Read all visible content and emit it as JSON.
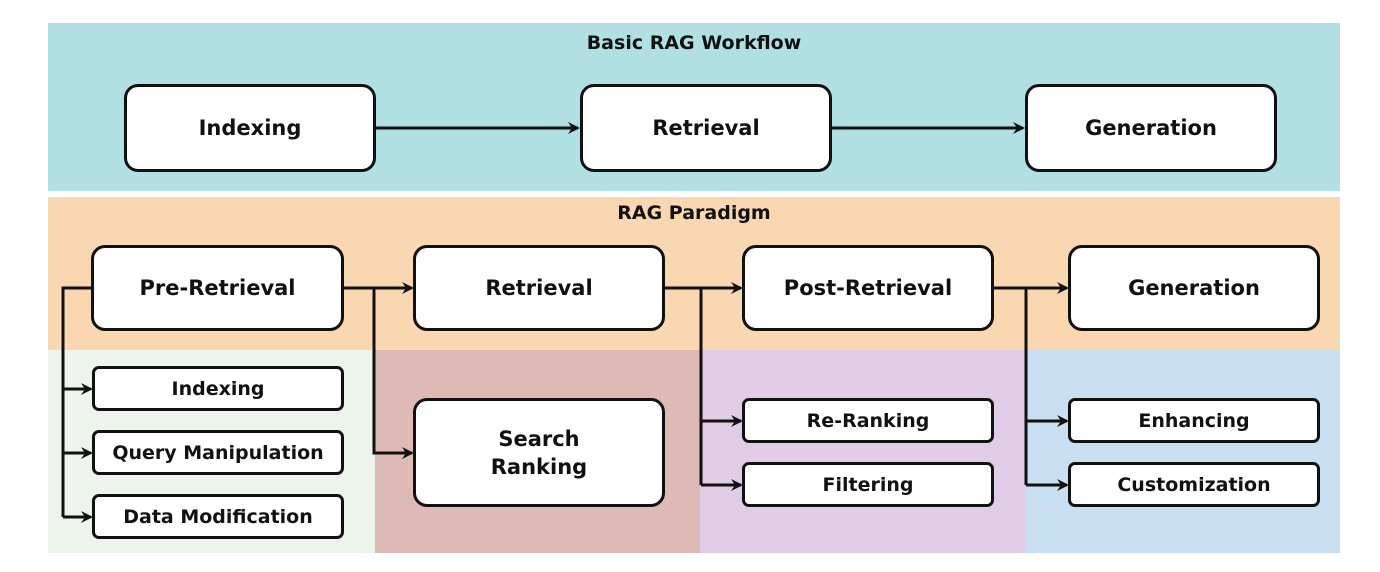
{
  "basic_workflow": {
    "title": "Basic RAG Workflow",
    "steps": [
      "Indexing",
      "Retrieval",
      "Generation"
    ]
  },
  "paradigm": {
    "title": "RAG Paradigm",
    "stages": [
      {
        "label": "Pre-Retrieval",
        "substeps": [
          "Indexing",
          "Query Manipulation",
          "Data Modification"
        ]
      },
      {
        "label": "Retrieval",
        "substeps": [
          "Search Ranking"
        ]
      },
      {
        "label": "Post-Retrieval",
        "substeps": [
          "Re-Ranking",
          "Filtering"
        ]
      },
      {
        "label": "Generation",
        "substeps": [
          "Enhancing",
          "Customization"
        ]
      }
    ]
  },
  "colors": {
    "basic_band": "#b0e0e3",
    "paradigm_band": "#f9d8b1",
    "pre_retrieval_col": "#edf4ec",
    "retrieval_col": "#ddbab6",
    "post_retrieval_col": "#e1cce7",
    "generation_col": "#c7dff0"
  }
}
